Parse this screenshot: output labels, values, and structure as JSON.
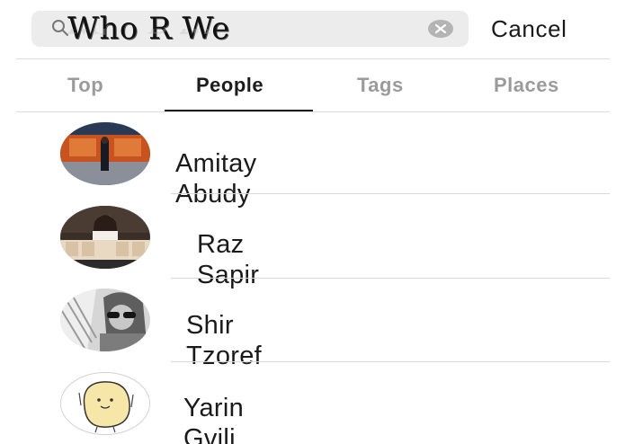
{
  "search": {
    "query": "Who R We",
    "cancel_label": "Cancel"
  },
  "tabs": [
    {
      "label": "Top",
      "active": false
    },
    {
      "label": "People",
      "active": true
    },
    {
      "label": "Tags",
      "active": false
    },
    {
      "label": "Places",
      "active": false
    }
  ],
  "results": [
    {
      "first": "Amitay",
      "last": "Abudy"
    },
    {
      "first": "Raz",
      "last": "Sapir"
    },
    {
      "first": "Shir",
      "last": "Tzoref"
    },
    {
      "first": "Yarin",
      "last": "Gvili"
    }
  ],
  "icons": {
    "search": "search-icon",
    "clear": "clear-icon"
  },
  "colors": {
    "search_field": "#ececec",
    "active_tab": "#1c1c1c",
    "inactive_tab": "#9b9b9b"
  }
}
